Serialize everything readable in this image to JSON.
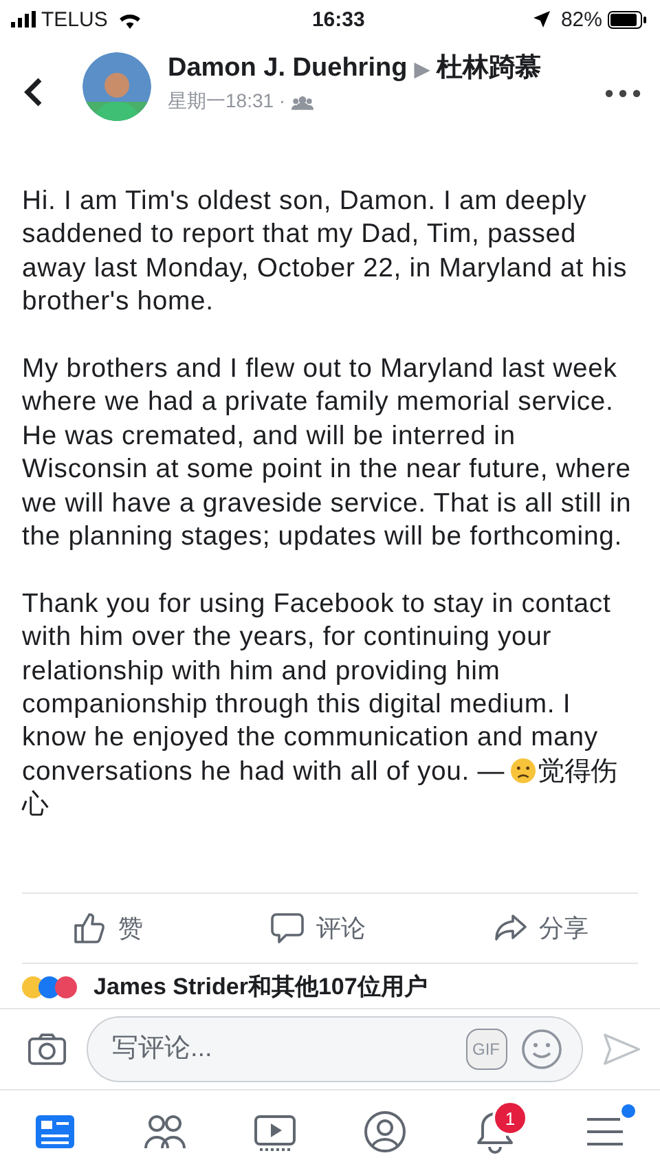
{
  "status_bar": {
    "carrier": "TELUS",
    "time": "16:33",
    "battery": "82%"
  },
  "post": {
    "author": "Damon J. Duehring",
    "arrow": "▶",
    "target": "杜林踦慕",
    "time": "星期一18:31 ·",
    "paragraphs": [
      "Hi. I am Tim's oldest son, Damon. I am deeply saddened to report that my Dad, Tim, passed away last Monday, October 22, in Maryland at his brother's home.",
      "My brothers and I flew out to Maryland last week where we had a private family memorial service. He was cremated, and will be interred in Wisconsin at some point in the near future, where we will have a graveside service. That is all still in the planning stages; updates will be forthcoming.",
      "Thank you for using Facebook to stay in contact with him over the years, for continuing your relationship with him and providing him companionship through this digital medium. I know he enjoyed the communication and many conversations he had with all of you. —"
    ],
    "feeling": "觉得伤心"
  },
  "actions": [
    {
      "kind": "like",
      "label": "赞"
    },
    {
      "kind": "comment",
      "label": "评论"
    },
    {
      "kind": "share",
      "label": "分享"
    }
  ],
  "reactions": {
    "text": "James Strider和其他107位用户"
  },
  "composer": {
    "placeholder": "写评论...",
    "gif_label": "GIF"
  },
  "tab_bar": [
    {
      "kind": "news",
      "selected": true
    },
    {
      "kind": "friends",
      "selected": false
    },
    {
      "kind": "watch",
      "selected": false
    },
    {
      "kind": "profile",
      "selected": false
    },
    {
      "kind": "bell",
      "selected": false,
      "badge": "1"
    },
    {
      "kind": "menu",
      "selected": false,
      "dot": true
    }
  ]
}
